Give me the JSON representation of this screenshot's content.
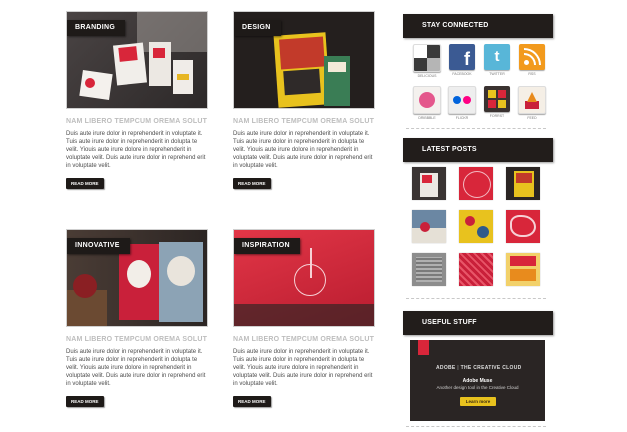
{
  "posts": [
    {
      "tag": "BRANDING",
      "title": "NAM LIBERO TEMPCUM OREMA SOLUT",
      "excerpt": "Duis aute irure dolor in reprehenderit in voluptate it. Tuis aute irure dolor in reprehenderit in dolupta te velit. Yiouis aute irure dolore in reprehenderit in voluptate velit. Duis aute irure dolor in reprehend erit in voluptate velit.",
      "more": "READ MORE"
    },
    {
      "tag": "DESIGN",
      "title": "NAM LIBERO TEMPCUM OREMA SOLUT",
      "excerpt": "Duis aute irure dolor in reprehenderit in voluptate it. Tuis aute irure dolor in reprehenderit in dolupta te velit. Yiouis aute irure dolore in reprehenderit in voluptate velit. Duis aute irure dolor in reprehend erit in voluptate velit.",
      "more": "READ MORE"
    },
    {
      "tag": "INNOVATIVE",
      "title": "NAM LIBERO TEMPCUM OREMA SOLUT",
      "excerpt": "Duis aute irure dolor in reprehenderit in voluptate it. Tuis aute irure dolor in reprehenderit in dolupta te velit. Yiouis aute irure dolore in reprehenderit in voluptate velit. Duis aute irure dolor in reprehend erit in voluptate velit.",
      "more": "READ MORE"
    },
    {
      "tag": "INSPIRATION",
      "title": "NAM LIBERO TEMPCUM OREMA SOLUT",
      "excerpt": "Duis aute irure dolor in reprehenderit in voluptate it. Tuis aute irure dolor in reprehenderit in dolupta te velit. Yiouis aute irure dolore in reprehenderit in voluptate velit. Duis aute irure dolor in reprehend erit in voluptate velit.",
      "more": "READ MORE"
    }
  ],
  "sidebar": {
    "stay_connected": "STAY CONNECTED",
    "latest_posts": "LATEST POSTS",
    "useful_stuff": "USEFUL STUFF",
    "social": [
      {
        "label": "DELICIOUS",
        "icon": "delicious-icon"
      },
      {
        "label": "FACEBOOK",
        "icon": "facebook-icon"
      },
      {
        "label": "TWITTER",
        "icon": "twitter-icon"
      },
      {
        "label": "RSS",
        "icon": "rss-icon"
      },
      {
        "label": "DRIBBBLE",
        "icon": "dribbble-icon"
      },
      {
        "label": "FLICKR",
        "icon": "flickr-icon"
      },
      {
        "label": "FORRST",
        "icon": "forrst-icon"
      },
      {
        "label": "FEED",
        "icon": "feed-icon"
      }
    ],
    "ad": {
      "brand": "ADOBE",
      "headline": "THE CREATIVE CLOUD",
      "product": "Adobe Muse",
      "subline": "Another design tool in the Creative Cloud",
      "cta": "Learn more"
    }
  },
  "colors": {
    "dark": "#221d1b",
    "accent_red": "#d8263a",
    "muted_title": "#bdbdbd"
  }
}
